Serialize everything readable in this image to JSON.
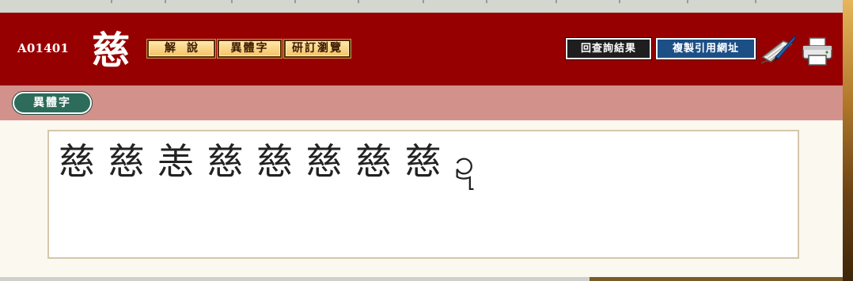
{
  "header": {
    "entry_code": "A01401",
    "headword": "慈",
    "tabs": [
      "解說",
      "異體字",
      "研訂瀏覽"
    ],
    "back_button": "回查詢結果",
    "copy_button": "複製引用網址"
  },
  "subnav": {
    "active_tab": "異體字"
  },
  "variants": [
    "慈",
    "慈",
    "恙",
    "慈",
    "慈",
    "慈",
    "慈",
    "慈",
    "ဍ"
  ],
  "icons": {
    "edit": "quill-pen-icon",
    "print": "printer-icon"
  },
  "colors": {
    "header_bg": "#970000",
    "subbar_bg": "#d3918b",
    "pill_bg": "#2d6b5a",
    "copy_btn_bg": "#1c4f86"
  }
}
